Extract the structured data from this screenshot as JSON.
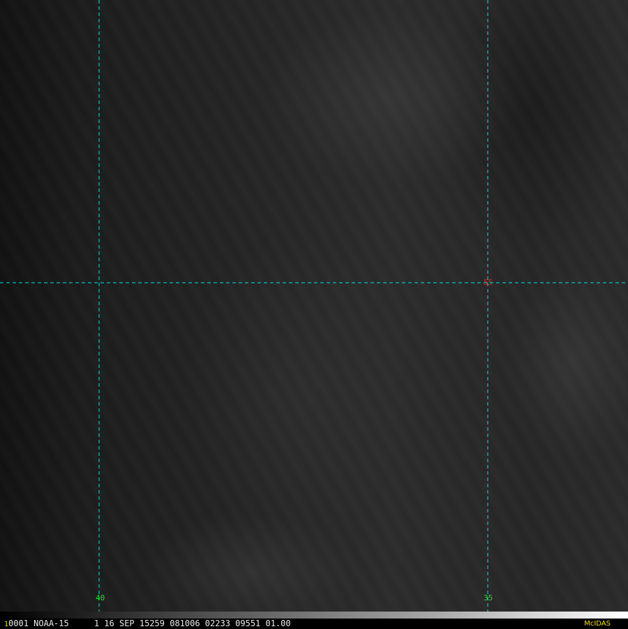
{
  "grid": {
    "longitudes": [
      {
        "label": "40"
      },
      {
        "label": "35"
      }
    ],
    "latitudes": [
      {
        "label": "55"
      }
    ],
    "line_color": "#00e5e5",
    "lon_label_color": "#22dd22",
    "lat_label_color": "#dd2222"
  },
  "status_bar": {
    "frame_number": "1",
    "info": "0001 NOAA-15     1 16 SEP 15259 081006 02233 09551 01.00",
    "brand": "McIDAS",
    "brand_color": "#f0e020"
  }
}
